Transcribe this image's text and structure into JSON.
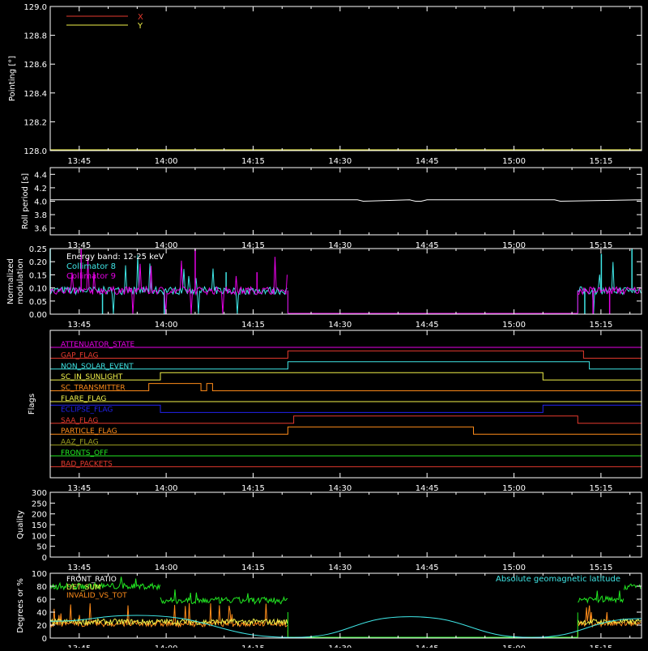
{
  "colors": {
    "background": "#000000",
    "axis": "#ffffff",
    "red": "#e53a2e",
    "yellow": "#f2f24a",
    "cyan": "#3fe6e6",
    "magenta": "#e600e6",
    "orange": "#ff8c1a",
    "blue": "#2222ee",
    "olive": "#a0a020",
    "green": "#22e822"
  },
  "time_ticks": [
    "13:45",
    "14:00",
    "14:15",
    "14:30",
    "14:45",
    "15:00",
    "15:15"
  ],
  "chart_data": [
    {
      "id": "pointing",
      "type": "line",
      "ylabel": "Pointing [°]",
      "ylim": [
        128.0,
        129.0
      ],
      "yticks": [
        "128.0",
        "128.2",
        "128.4",
        "128.6",
        "128.8",
        "129.0"
      ],
      "legend": {
        "placement": "top-left",
        "entries": [
          "X",
          "Y"
        ]
      },
      "series": [
        {
          "name": "X",
          "color": "#e53a2e",
          "x": [],
          "y": []
        },
        {
          "name": "Y",
          "color": "#f2f24a",
          "x": [
            "13:40",
            "15:22"
          ],
          "y": [
            128.0,
            128.0
          ]
        }
      ]
    },
    {
      "id": "roll_period",
      "type": "line",
      "ylabel": "Roll period [s]",
      "ylim": [
        3.5,
        4.5
      ],
      "yticks": [
        "3.6",
        "3.8",
        "4.0",
        "4.2",
        "4.4"
      ],
      "series": [
        {
          "color": "#ffffff",
          "x": [
            "13:40",
            "14:33",
            "14:34",
            "14:42",
            "14:43",
            "14:44",
            "14:45",
            "15:07",
            "15:08",
            "15:22"
          ],
          "y": [
            4.02,
            4.02,
            4.0,
            4.02,
            4.0,
            4.0,
            4.02,
            4.02,
            4.0,
            4.02
          ]
        }
      ]
    },
    {
      "id": "modulation",
      "type": "line",
      "ylabel": "Normalized modulation",
      "ylim": [
        0.0,
        0.25
      ],
      "yticks": [
        "0.00",
        "0.05",
        "0.10",
        "0.15",
        "0.20",
        "0.25"
      ],
      "annotations": [
        "Energy band: 12-25 keV"
      ],
      "legend": {
        "placement": "top-left",
        "entries": [
          "Collimator 8",
          "Collimator 9"
        ]
      },
      "series": [
        {
          "name": "Collimator 8",
          "color": "#3fe6e6",
          "segments": [
            [
              "13:40",
              "14:21"
            ],
            [
              "15:11",
              "15:22"
            ]
          ],
          "base": 0.09,
          "spikes": [
            0.25,
            0.23,
            0.16,
            0.0,
            0.0,
            0.25,
            0.0
          ]
        },
        {
          "name": "Collimator 9",
          "color": "#e600e6",
          "segments": [
            [
              "13:40",
              "14:21"
            ],
            [
              "15:11",
              "15:22"
            ]
          ],
          "base": 0.09,
          "spikes": [
            0.25,
            0.0,
            0.16,
            0.0,
            0.25
          ]
        }
      ]
    },
    {
      "id": "flags",
      "type": "line",
      "ylabel": "Flags",
      "flags": [
        {
          "name": "ATTENUATOR_STATE",
          "color": "#e600e6",
          "high": []
        },
        {
          "name": "GAP_FLAG",
          "color": "#e53a2e",
          "high": [
            [
              "14:21",
              "15:12"
            ]
          ]
        },
        {
          "name": "NON_SOLAR_EVENT",
          "color": "#3fe6e6",
          "high": [
            [
              "14:21",
              "15:13"
            ]
          ]
        },
        {
          "name": "SC_IN_SUNLIGHT",
          "color": "#f2f24a",
          "high": [
            [
              "13:59",
              "15:05"
            ]
          ]
        },
        {
          "name": "SC_TRANSMITTER",
          "color": "#ff8c1a",
          "high": [
            [
              "13:57",
              "14:06"
            ],
            [
              "14:07",
              "14:08"
            ]
          ]
        },
        {
          "name": "FLARE_FLAG",
          "color": "#f2f24a",
          "high": []
        },
        {
          "name": "ECLIPSE_FLAG",
          "color": "#2222ee",
          "high": [
            [
              "13:40",
              "13:59"
            ],
            [
              "15:05",
              "15:22"
            ]
          ]
        },
        {
          "name": "SAA_FLAG",
          "color": "#e53a2e",
          "high": [
            [
              "14:22",
              "15:11"
            ]
          ]
        },
        {
          "name": "PARTICLE_FLAG",
          "color": "#ff8c1a",
          "high": [
            [
              "14:21",
              "14:53"
            ]
          ]
        },
        {
          "name": "AAZ_FLAG",
          "color": "#a0a020",
          "high": []
        },
        {
          "name": "FRONTS_OFF",
          "color": "#22e822",
          "high": []
        },
        {
          "name": "BAD_PACKETS",
          "color": "#e53a2e",
          "high": []
        }
      ]
    },
    {
      "id": "quality",
      "type": "line",
      "ylabel": "Quality",
      "ylim": [
        0,
        300
      ],
      "yticks": [
        "0",
        "50",
        "100",
        "150",
        "200",
        "250",
        "300"
      ],
      "series": []
    },
    {
      "id": "ratios",
      "type": "line",
      "ylabel": "Degrees or %",
      "ylim": [
        0,
        100
      ],
      "yticks": [
        "0",
        "20",
        "40",
        "60",
        "80",
        "100"
      ],
      "legend": {
        "entries": [
          "FRONT_RATIO",
          "DET_SUM",
          "INVALID_VS_TOT",
          "Absolute geomagnetic latitude"
        ]
      },
      "series": [
        {
          "name": "FRONT_RATIO",
          "color": "#22e822",
          "segments": [
            [
              "13:40",
              "13:59"
            ],
            [
              "13:59",
              "14:21"
            ],
            [
              "15:11",
              "15:19"
            ],
            [
              "15:19",
              "15:22"
            ]
          ],
          "levels": [
            80,
            58,
            60,
            79
          ]
        },
        {
          "name": "DET_SUM",
          "color": "#f2f24a",
          "segments": [
            [
              "13:40",
              "14:21"
            ],
            [
              "15:11",
              "15:22"
            ]
          ],
          "levels": [
            25,
            25
          ]
        },
        {
          "name": "INVALID_VS_TOT",
          "color": "#ff8c1a",
          "segments": [
            [
              "13:40",
              "14:21"
            ],
            [
              "15:11",
              "15:22"
            ]
          ],
          "levels": [
            22,
            22
          ]
        },
        {
          "name": "Absolute geomagnetic latitude",
          "color": "#3fe6e6",
          "x": [
            "13:40",
            "13:55",
            "14:22",
            "14:42",
            "15:03",
            "15:22"
          ],
          "y": [
            26,
            35,
            1,
            33,
            1,
            30
          ]
        }
      ]
    }
  ]
}
